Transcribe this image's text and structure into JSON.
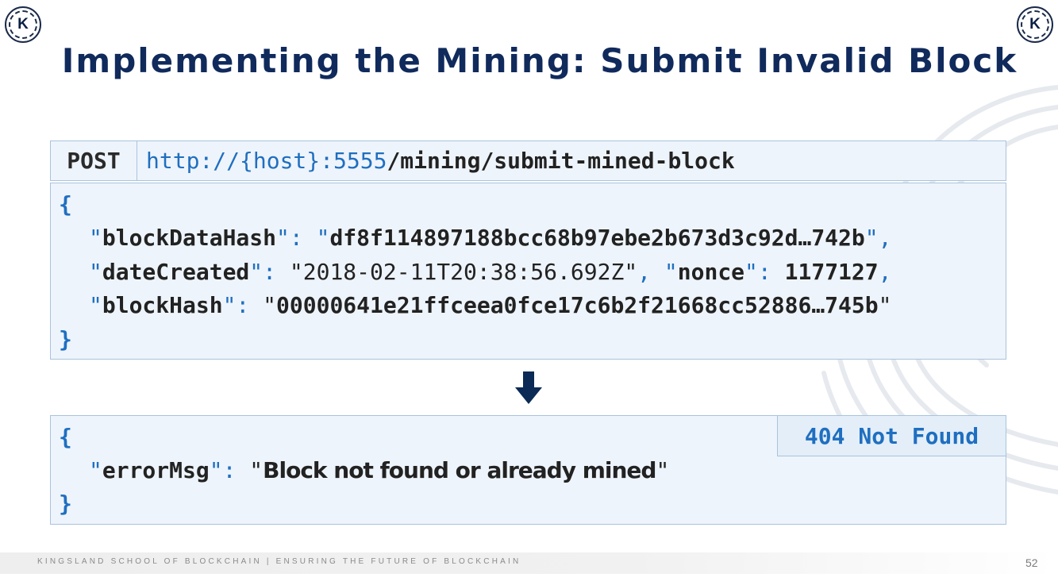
{
  "logo": {
    "letter": "K"
  },
  "title": "Implementing the Mining: Submit Invalid Block",
  "request": {
    "method": "POST",
    "url_prefix": "http://{host}:5555",
    "url_path": "/mining/submit-mined-block",
    "open_brace": "{",
    "close_brace": "}",
    "fields": {
      "blockDataHash_key": "blockDataHash",
      "blockDataHash_value": "df8f114897188bcc68b97ebe2b673d3c92d…742b",
      "dateCreated_key": "dateCreated",
      "dateCreated_value": "2018-02-11T20:38:56.692Z",
      "nonce_key": "nonce",
      "nonce_value": "1177127",
      "blockHash_key": "blockHash",
      "blockHash_value": "00000641e21ffceea0fce17c6b2f21668cc52886…745b"
    }
  },
  "response": {
    "status": "404 Not Found",
    "open_brace": "{",
    "close_brace": "}",
    "errorMsg_key": "errorMsg",
    "errorMsg_value": "Block not found or already mined"
  },
  "footer": {
    "text": "KINGSLAND SCHOOL OF BLOCKCHAIN | ENSURING THE FUTURE OF BLOCKCHAIN",
    "page": "52"
  },
  "colors": {
    "title": "#102a5c",
    "accent_blue": "#1f6fc0",
    "box_bg": "#eef4fb",
    "box_border": "#a9c3de",
    "arrow": "#0b2a55"
  }
}
